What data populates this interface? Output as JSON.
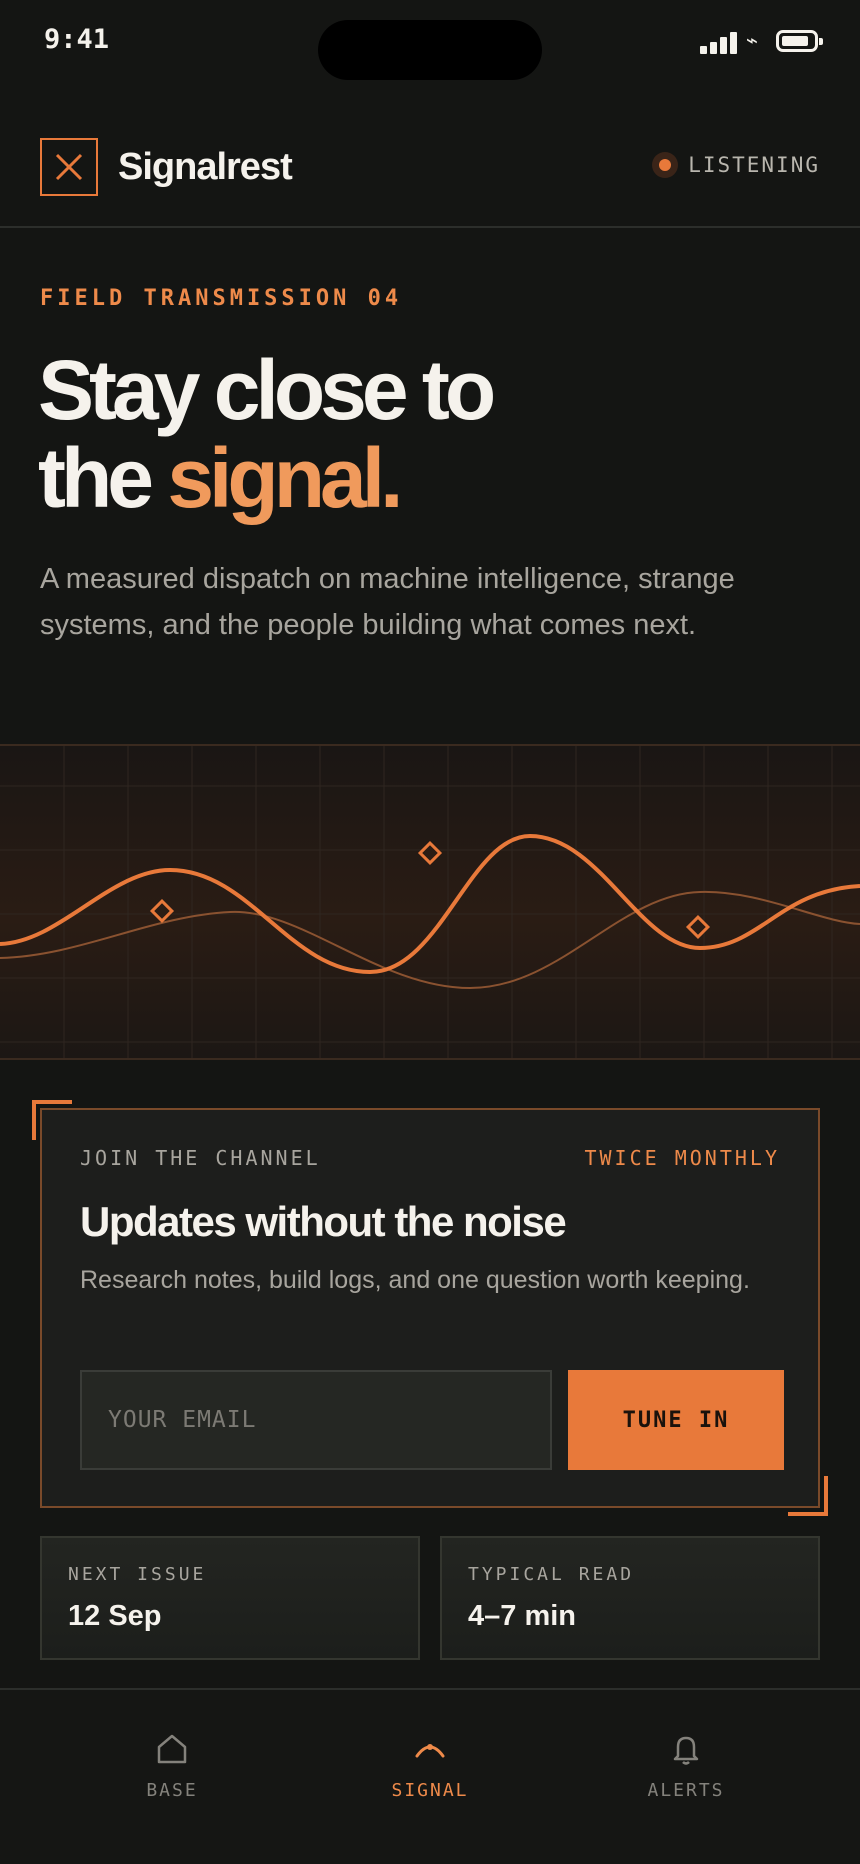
{
  "status_bar": {
    "time": "9:41"
  },
  "header": {
    "brand": "Signalrest",
    "status_label": "LISTENING"
  },
  "hero": {
    "eyebrow": "FIELD TRANSMISSION 04",
    "headline_line1": "Stay close to",
    "headline_line2_prefix": "the ",
    "headline_accent": "signal.",
    "lede": "A measured dispatch on machine intelligence, strange systems, and the people building what comes next."
  },
  "subscribe": {
    "kicker": "JOIN THE CHANNEL",
    "frequency": "TWICE MONTHLY",
    "title": "Updates without the noise",
    "description": "Research notes, build logs, and one question worth keeping.",
    "email_placeholder": "YOUR EMAIL",
    "email_value": "",
    "button_label": "TUNE IN"
  },
  "stats": [
    {
      "label": "NEXT ISSUE",
      "value": "12 Sep"
    },
    {
      "label": "TYPICAL READ",
      "value": "4–7 min"
    }
  ],
  "nav": [
    {
      "label": "BASE",
      "icon": "home-icon",
      "active": false
    },
    {
      "label": "SIGNAL",
      "icon": "signal-icon",
      "active": true
    },
    {
      "label": "ALERTS",
      "icon": "bell-icon",
      "active": false
    }
  ],
  "colors": {
    "accent": "#e8793a",
    "accent_light": "#f09a5c",
    "background": "#141513",
    "muted_text": "#a8a59e"
  }
}
